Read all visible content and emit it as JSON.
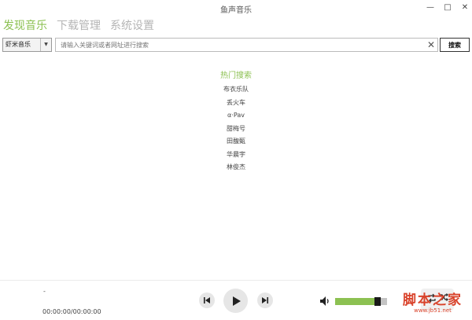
{
  "window": {
    "title": "鱼声音乐",
    "minimize_glyph": "—",
    "maximize_glyph": "□",
    "close_glyph": "✕"
  },
  "nav": {
    "tabs": [
      {
        "label": "发现音乐",
        "active": true
      },
      {
        "label": "下载管理",
        "active": false
      },
      {
        "label": "系统设置",
        "active": false
      }
    ]
  },
  "search": {
    "source": "虾米音乐",
    "placeholder": "请输入关键词或者网址进行搜索",
    "value": "",
    "button_label": "搜索"
  },
  "hot_search": {
    "title": "热门搜索",
    "items": [
      "布衣乐队",
      "丢火车",
      "α·Pav",
      "甜梅号",
      "田馥甄",
      "华晨宇",
      "林俊杰"
    ]
  },
  "player": {
    "track_name": "-",
    "time": "00:00:00/00:00:00",
    "volume": 0.82
  },
  "icons": {
    "prev": "prev-icon",
    "play": "play-icon",
    "next": "next-icon",
    "volume": "volume-icon",
    "repeat": "repeat-icon",
    "shuffle": "shuffle-icon",
    "close": "close-icon",
    "dropdown": "chevron-down-icon"
  },
  "colors": {
    "accent": "#8cc152",
    "inactive_tab": "#b5b5b5",
    "watermark": "#d9432b"
  },
  "watermark": {
    "logo": "脚本之家",
    "url": "www.jb51.net"
  }
}
